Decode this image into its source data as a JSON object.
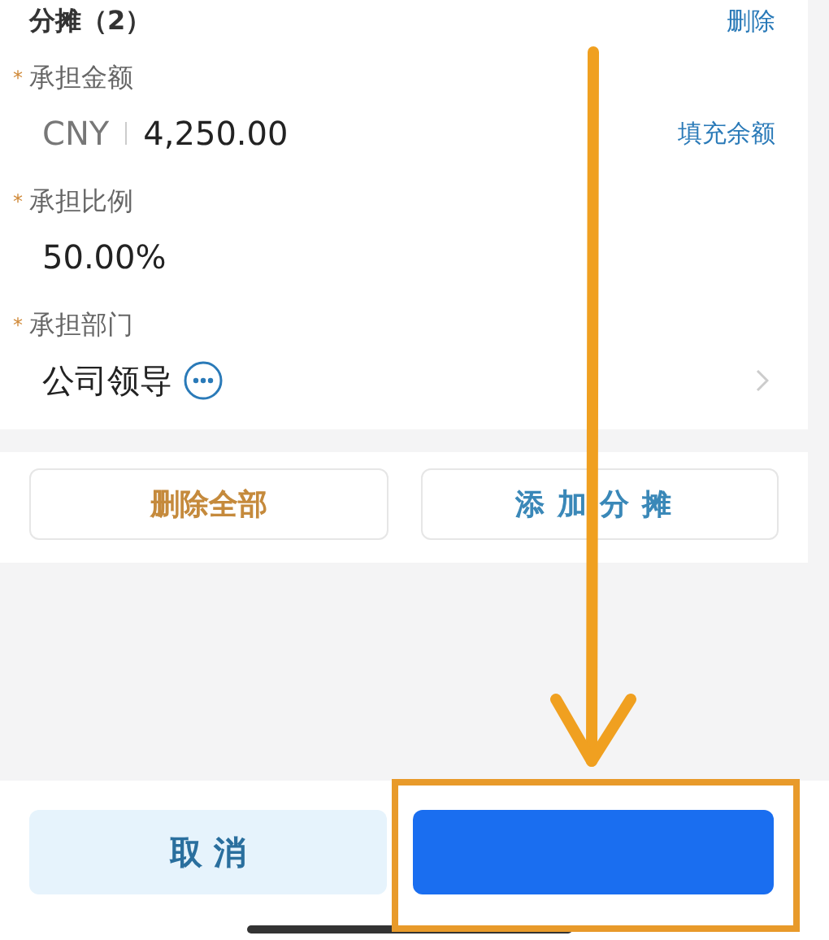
{
  "section": {
    "title": "分摊（2）",
    "action": "删除"
  },
  "fields": [
    {
      "kind": "amount",
      "label": "承担金额",
      "mark": "*",
      "currency": "CNY",
      "value": "4,250.00",
      "action": "填充余额"
    },
    {
      "kind": "text",
      "label": "承担比例",
      "mark": "*",
      "value": "50.00%"
    },
    {
      "kind": "select",
      "label": "承担部门",
      "mark": "*",
      "value": "公司领导"
    }
  ],
  "actions": [
    "删除全部",
    "添加分摊"
  ],
  "footer": {
    "cancel": "取 消"
  }
}
